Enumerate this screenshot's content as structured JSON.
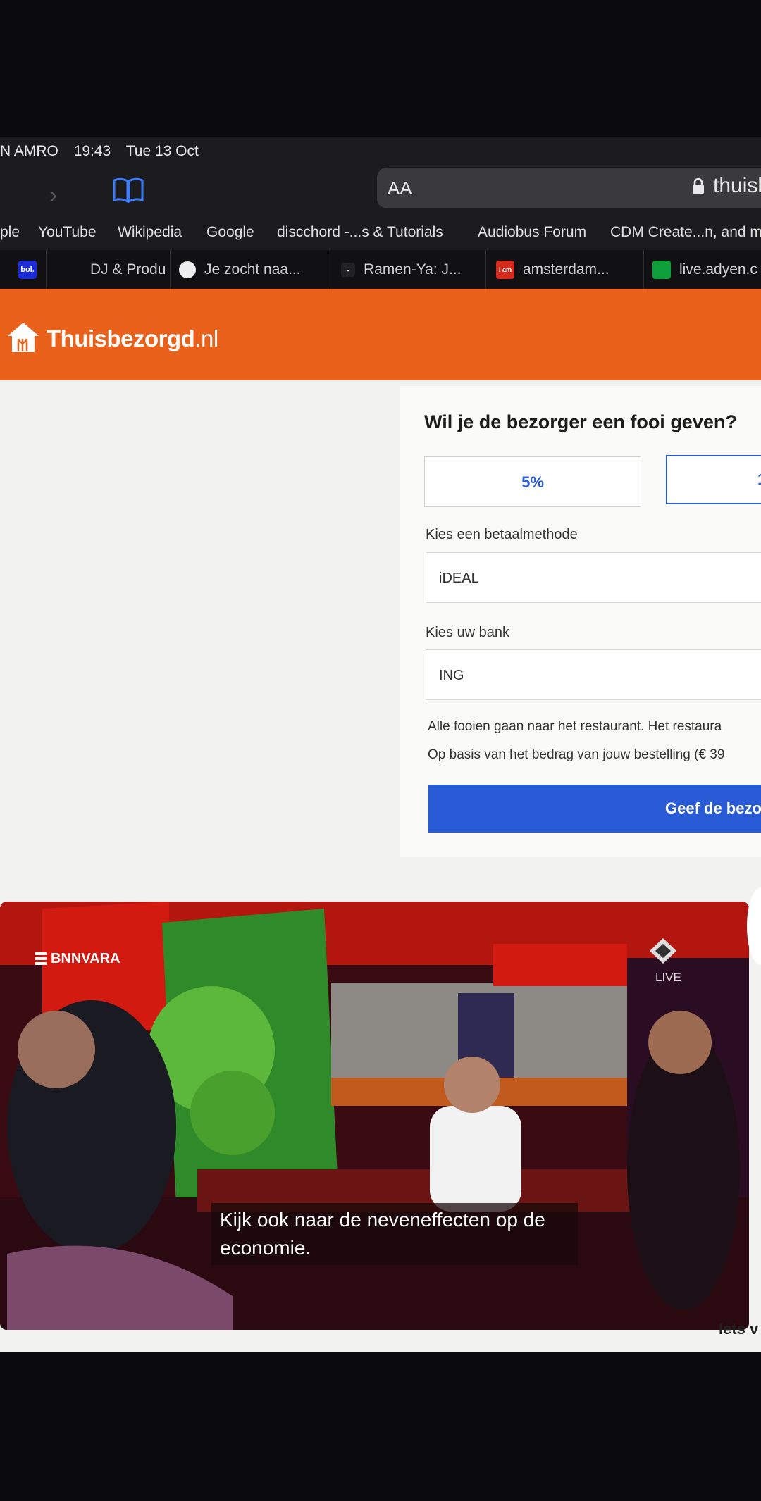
{
  "status_bar": {
    "carrier": "N AMRO",
    "time": "19:43",
    "date": "Tue 13 Oct"
  },
  "address_bar": {
    "aa_label": "AA",
    "url": "thuisb"
  },
  "favorites": [
    "ple",
    "YouTube",
    "Wikipedia",
    "Google",
    "discchord -...s & Tutorials",
    "Audiobus Forum",
    "CDM Create...n, and m"
  ],
  "tabs": [
    {
      "icon_text": "bol.",
      "icon_color": "#1b2bd6",
      "label": ""
    },
    {
      "icon_text": "",
      "icon_color": "",
      "label": "DJ & Produ"
    },
    {
      "icon_text": "",
      "icon_color": "#eeeeee",
      "label": "Je zocht naa..."
    },
    {
      "icon_text": "",
      "icon_color": "#eeeeee",
      "label": "Ramen-Ya: J..."
    },
    {
      "icon_text": "I am",
      "icon_color": "#d52b1e",
      "label": "amsterdam..."
    },
    {
      "icon_text": "",
      "icon_color": "#0e9f3a",
      "label": "live.adyen.c"
    }
  ],
  "site": {
    "brand": "Thuisbezorgd",
    "tld": ".nl",
    "brand_color": "#e9611a",
    "accent_color": "#2a5bd7"
  },
  "tip_form": {
    "title": "Wil je de bezorger een fooi geven?",
    "options": [
      "5%",
      "1"
    ],
    "payment_label": "Kies een betaalmethode",
    "payment_value": "iDEAL",
    "bank_label": "Kies uw bank",
    "bank_value": "ING",
    "info_line_1": "Alle fooien gaan naar het restaurant. Het restaura",
    "info_line_2": "Op basis van het bedrag van jouw bestelling (€ 39",
    "submit_label": "Geef de bezo"
  },
  "video": {
    "channel": "BNNVARA",
    "live_label": "LIVE",
    "subtitle": "Kijk ook naar de neveneffecten op de economie."
  },
  "side_text": "Iets v"
}
